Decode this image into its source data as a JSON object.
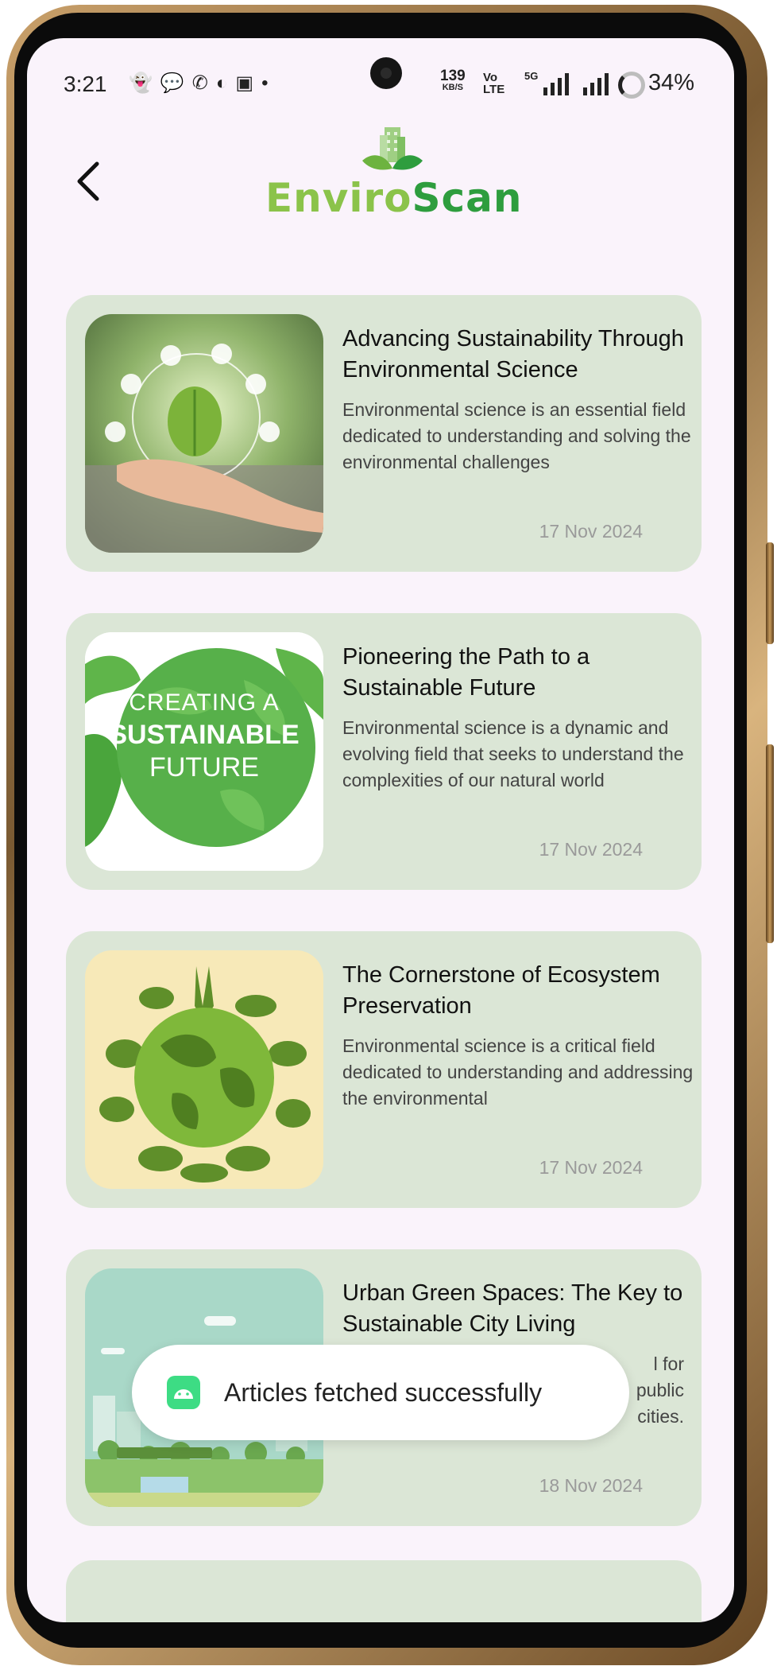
{
  "status_bar": {
    "time": "3:21",
    "net_speed_value": "139",
    "net_speed_unit": "KB/S",
    "volte_top": "Vo",
    "volte_bottom": "LTE",
    "network": "5G",
    "battery": "34%",
    "notification_icons": [
      "snapchat-icon",
      "chat-icon",
      "whatsapp-icon",
      "app-icon",
      "gift-icon",
      "more-dot"
    ]
  },
  "header": {
    "back_icon": "chevron-left-icon",
    "logo_part1": "Enviro",
    "logo_part2": "Scan"
  },
  "colors": {
    "screen_bg": "#faf3fb",
    "card_bg": "#dbe6d6",
    "logo_light_green": "#8bc34a",
    "logo_dark_green": "#2e9d3e",
    "toast_icon_green": "#3ddc84"
  },
  "articles": [
    {
      "title": "Advancing Sustainability Through Environmental Science",
      "description": "Environmental science is an essential field dedicated to understanding and solving the environmental challenges",
      "date": "17 Nov 2024"
    },
    {
      "title": "Pioneering the Path to a Sustainable Future",
      "description": "Environmental science is a dynamic and evolving field that seeks to understand the complexities of our natural world",
      "date": "17 Nov 2024",
      "image_text": [
        "CREATING A",
        "SUSTAINABLE",
        "FUTURE"
      ]
    },
    {
      "title": "The Cornerstone of Ecosystem Preservation",
      "description": "Environmental science is a critical field dedicated to understanding and addressing the environmental",
      "date": "17 Nov 2024"
    },
    {
      "title": "Urban Green Spaces: The Key to Sustainable City Living",
      "description_visible_fragments": [
        "l for",
        "public",
        "cities."
      ],
      "date": "18 Nov 2024"
    }
  ],
  "toast": {
    "message": "Articles fetched successfully",
    "icon": "android-icon"
  }
}
